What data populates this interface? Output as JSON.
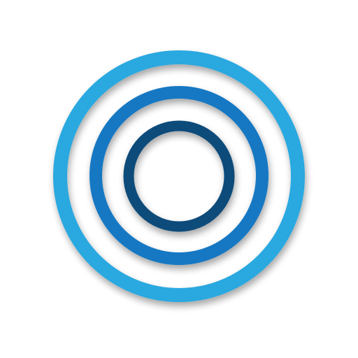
{
  "logo": {
    "name": "concentric-rings-logo",
    "rings": [
      {
        "name": "outer-ring",
        "color": "#29A8E0"
      },
      {
        "name": "middle-ring",
        "color": "#1478C3"
      },
      {
        "name": "inner-ring",
        "color": "#0B4B7A"
      }
    ],
    "background_color": "#FFFFFF"
  }
}
